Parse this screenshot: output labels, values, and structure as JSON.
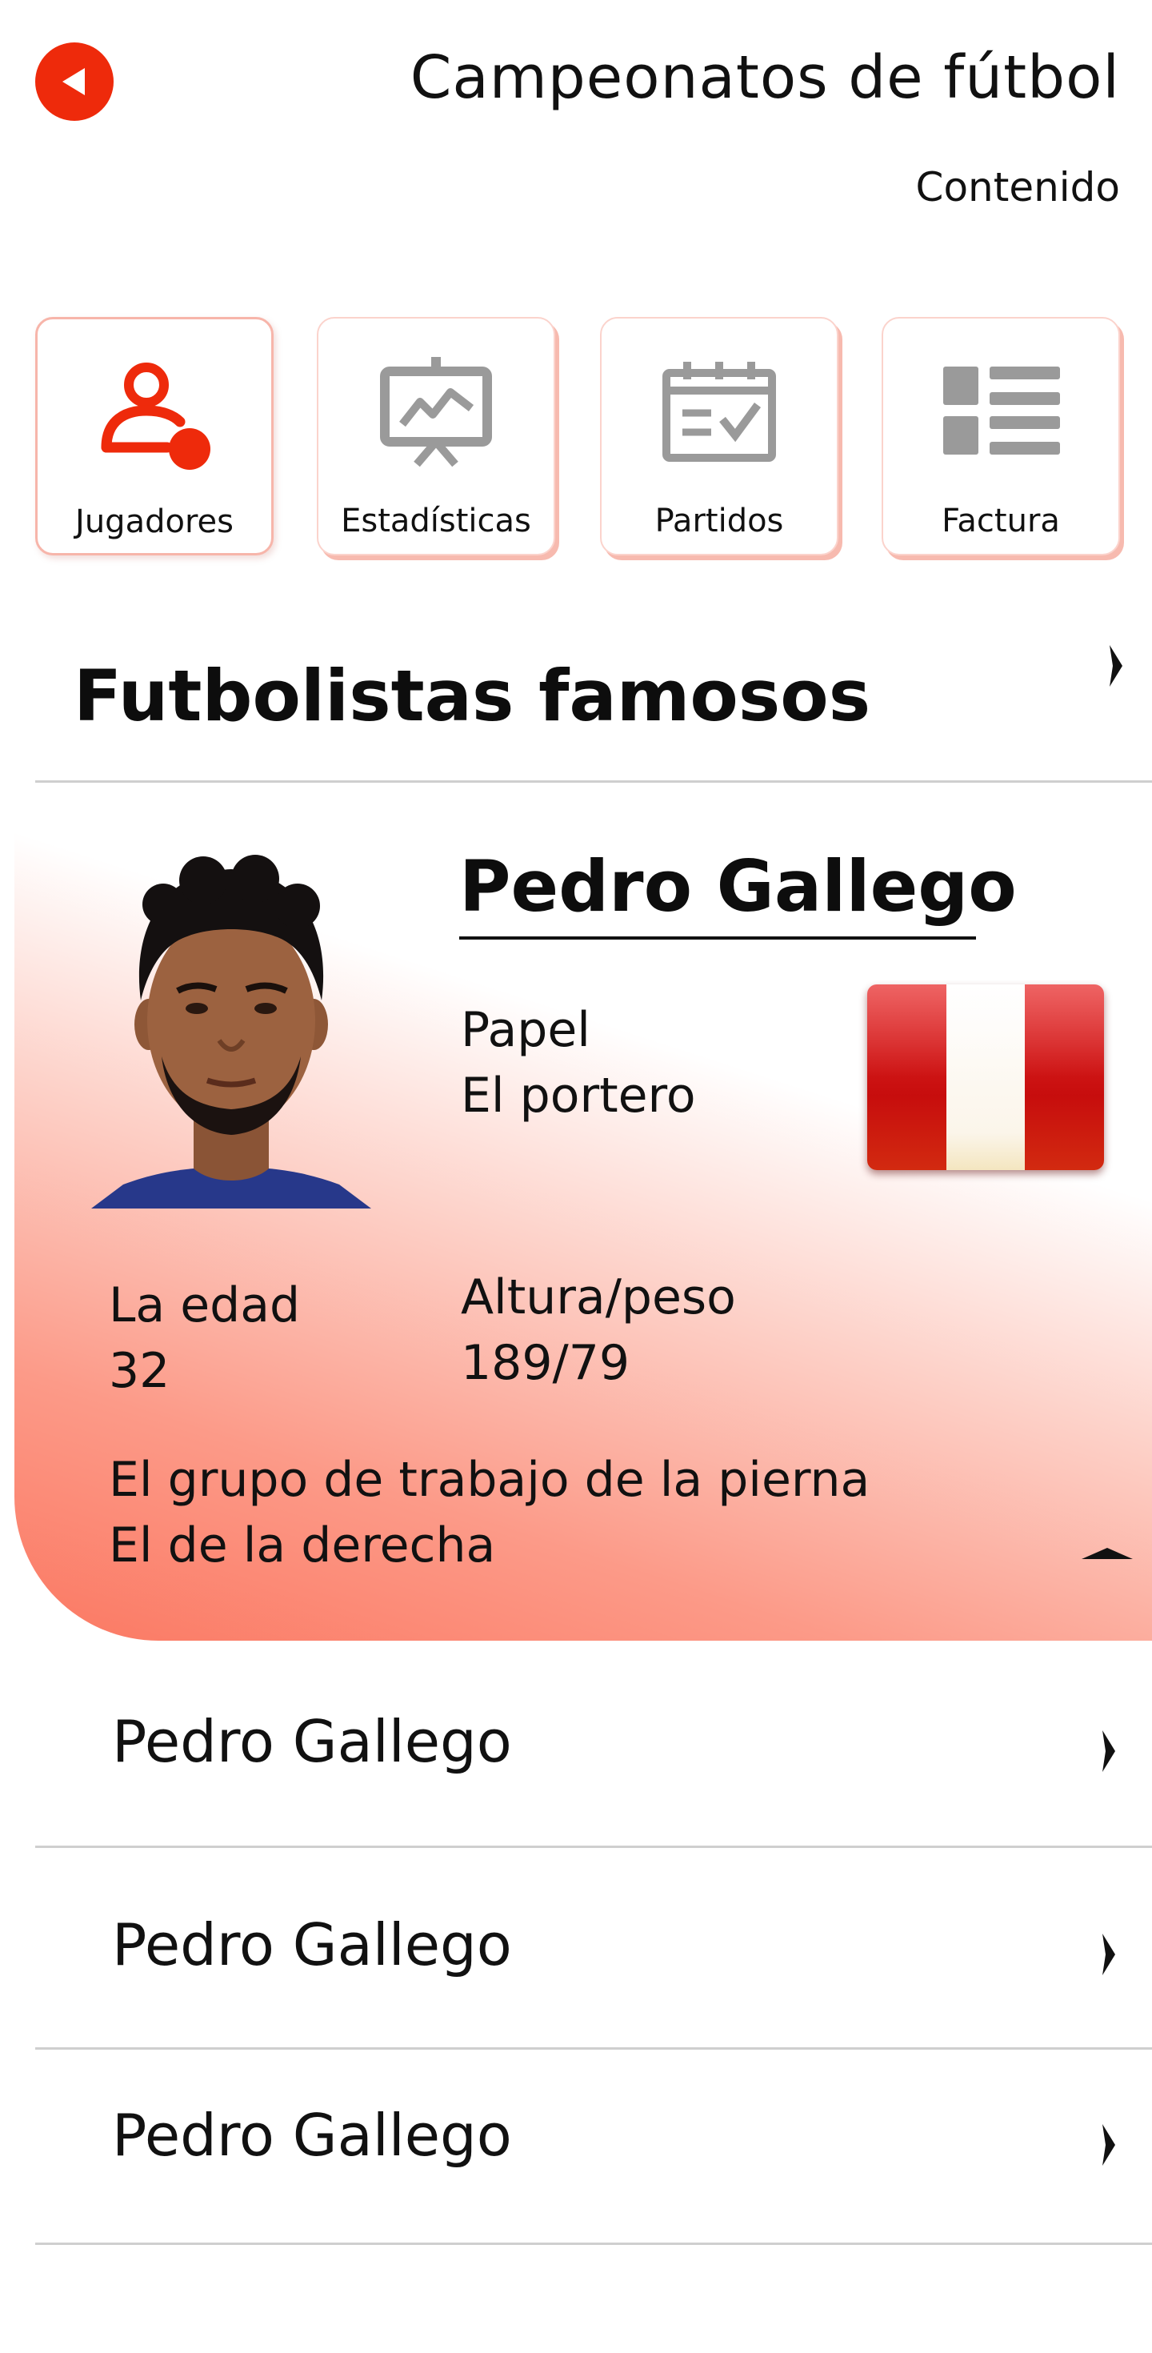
{
  "header": {
    "title": "Campeonatos de fútbol",
    "subtitle": "Contenido",
    "back_icon": "chevron-left-icon"
  },
  "tabs": [
    {
      "label": "Jugadores",
      "icon": "player-icon",
      "active": true
    },
    {
      "label": "Estadísticas",
      "icon": "stats-chart-icon",
      "active": false
    },
    {
      "label": "Partidos",
      "icon": "calendar-check-icon",
      "active": false
    },
    {
      "label": "Factura",
      "icon": "list-icon",
      "active": false
    }
  ],
  "section": {
    "title": "Futbolistas famosos"
  },
  "expanded_player": {
    "name": "Pedro Gallego",
    "role_label": "Papel",
    "role_value": "El portero",
    "age_label": "La edad",
    "age_value": "32",
    "height_weight_label": "Altura/peso",
    "height_weight_value": "189/79",
    "foot_label": "El grupo de trabajo de la pierna",
    "foot_value": "El de la derecha",
    "flag": "peru-flag"
  },
  "players": [
    {
      "name": "Pedro Gallego"
    },
    {
      "name": "Pedro Gallego"
    },
    {
      "name": "Pedro Gallego"
    }
  ],
  "colors": {
    "accent": "#ee2a0b",
    "icon_gray": "#9a9a9a",
    "card_gradient_strong": "#fb7862",
    "divider": "#cfcfcf"
  }
}
